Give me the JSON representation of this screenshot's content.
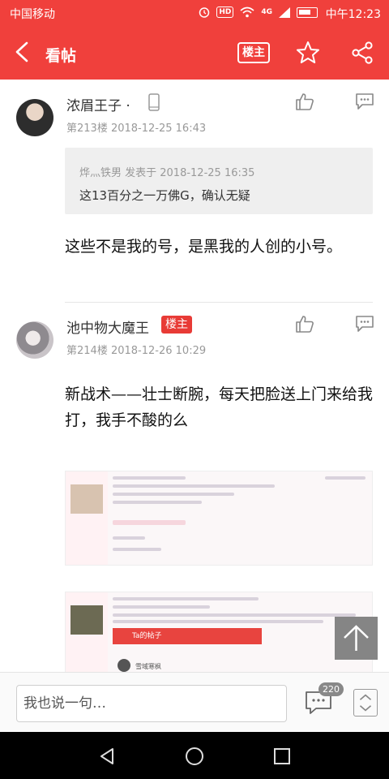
{
  "status_bar": {
    "carrier": "中国移动",
    "hd": "HD",
    "signal": "4G",
    "time": "中午12:23"
  },
  "header": {
    "title": "看帖",
    "owner_button": "楼主"
  },
  "posts": [
    {
      "username": "浓眉王子 ·",
      "floor": "第213楼",
      "datetime": "2018-12-25 16:43",
      "quote": {
        "meta": "烨灬铁男 发表于 2018-12-25 16:35",
        "text": "这13百分之一万佛G，确认无疑"
      },
      "text": "这些不是我的号，是黑我的人创的小号。"
    },
    {
      "username": "池中物大魔王",
      "badge": "楼主",
      "floor": "第214楼",
      "datetime": "2018-12-26 10:29",
      "text": "新战术——壮士断腕，每天把脸送上门来给我打，我手不酸的么",
      "embedded": [
        {
          "bar_text": "Ta的帖子",
          "name": "雪域寒枫"
        }
      ]
    }
  ],
  "reply": {
    "placeholder": "我也说一句…",
    "comment_count": "220"
  }
}
